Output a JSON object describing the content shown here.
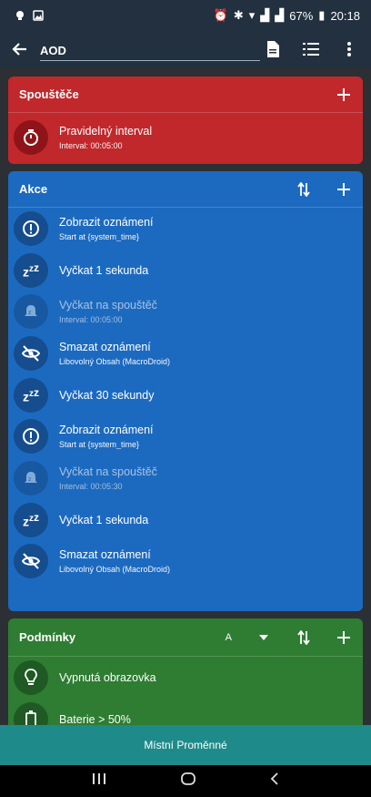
{
  "statusbar": {
    "battery": "67%",
    "time": "20:18"
  },
  "appbar": {
    "title": "AOD"
  },
  "triggers": {
    "title": "Spouštěče",
    "color": "#c0282c",
    "items": [
      {
        "label": "Pravidelný interval",
        "sub": "Interval: 00:05:00"
      }
    ]
  },
  "actions": {
    "title": "Akce",
    "color": "#1c6ac0",
    "items": [
      {
        "label": "Zobrazit oznámení",
        "sub": "Start at {system_time}"
      },
      {
        "label": "Vyčkat 1 sekunda",
        "sub": ""
      },
      {
        "label": "Vyčkat na spouštěč",
        "sub": "Interval: 00:05:00"
      },
      {
        "label": "Smazat oznámení",
        "sub": "Libovolný Obsah (MacroDroid)"
      },
      {
        "label": "Vyčkat 30 sekundy",
        "sub": ""
      },
      {
        "label": "Zobrazit oznámení",
        "sub": "Start at {system_time}"
      },
      {
        "label": "Vyčkat na spouštěč",
        "sub": "Interval: 00:05:30"
      },
      {
        "label": "Vyčkat 1 sekunda",
        "sub": ""
      },
      {
        "label": "Smazat oznámení",
        "sub": "Libovolný Obsah (MacroDroid)"
      }
    ]
  },
  "conditions": {
    "title": "Podmínky",
    "logic": "A",
    "color": "#2e7d32",
    "items": [
      {
        "label": "Vypnutá obrazovka",
        "sub": ""
      },
      {
        "label": "Baterie > 50%",
        "sub": ""
      }
    ]
  },
  "bottom_button": {
    "label": "Místní Proměnné"
  },
  "colors": {
    "trigger_circle": "#8e1419",
    "action_circle": "#154d8e",
    "condition_circle": "#1f5a24"
  }
}
